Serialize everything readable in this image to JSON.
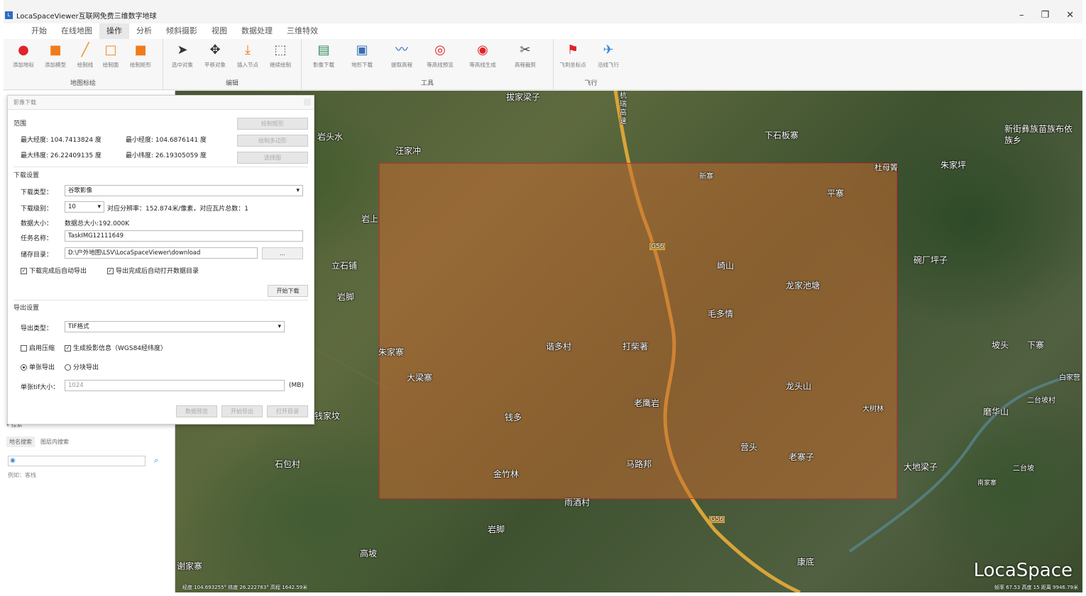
{
  "window": {
    "title": "LocaSpaceViewer互联网免费三维数字地球",
    "minimize": "–",
    "restore": "❐",
    "close": "✕"
  },
  "menu": [
    "开始",
    "在线地图",
    "操作",
    "分析",
    "倾斜摄影",
    "视图",
    "数据处理",
    "三维特效"
  ],
  "ribbon": {
    "groups": [
      {
        "label": "地图标绘",
        "buttons": [
          {
            "label": "添加地标",
            "icon": "location-pin-icon"
          },
          {
            "label": "添加模型",
            "icon": "cube-icon"
          },
          {
            "label": "绘制线",
            "icon": "line-icon"
          },
          {
            "label": "绘制面",
            "icon": "polygon-icon"
          },
          {
            "label": "绘制矩形",
            "icon": "rectangle-icon"
          }
        ]
      },
      {
        "label": "编辑",
        "buttons": [
          {
            "label": "选中对象",
            "icon": "cursor-icon"
          },
          {
            "label": "平移对象",
            "icon": "move-icon"
          },
          {
            "label": "插入节点",
            "icon": "insert-node-icon"
          },
          {
            "label": "继续绘制",
            "icon": "continue-draw-icon"
          }
        ]
      },
      {
        "label": "工具",
        "buttons": [
          {
            "label": "影像下载",
            "icon": "image-download-icon"
          },
          {
            "label": "地形下载",
            "icon": "terrain-download-icon"
          },
          {
            "label": "提取高程",
            "icon": "elevation-icon"
          },
          {
            "label": "等高线预览",
            "icon": "contour-preview-icon"
          },
          {
            "label": "等高线生成",
            "icon": "contour-generate-icon"
          },
          {
            "label": "高程裁剪",
            "icon": "scissors-icon"
          }
        ]
      },
      {
        "label": "飞行",
        "buttons": [
          {
            "label": "飞到坐标点",
            "icon": "fly-to-point-icon"
          },
          {
            "label": "沿线飞行",
            "icon": "airplane-icon"
          }
        ]
      }
    ]
  },
  "dialog": {
    "title": "影像下载",
    "range_title": "范围",
    "max_lon_label": "最大经度:",
    "max_lon": "104.7413824",
    "max_lon_unit": "度",
    "min_lon_label": "最小经度:",
    "min_lon": "104.6876141",
    "min_lon_unit": "度",
    "max_lat_label": "最大纬度:",
    "max_lat": "26.22409135",
    "max_lat_unit": "度",
    "min_lat_label": "最小纬度:",
    "min_lat": "26.19305059",
    "min_lat_unit": "度",
    "btn_draw_rect": "绘制矩形",
    "btn_draw_polygon": "绘制多边形",
    "btn_select_layer": "选择图",
    "download_settings": "下载设置",
    "dl_type_label": "下载类型：",
    "dl_type": "谷歌影像",
    "dl_level_label": "下载级别：",
    "dl_level": "10",
    "resolution_text": "对应分辨率：152.874米/像素，对应瓦片总数：1",
    "data_size_label": "数据大小：",
    "data_size": "数据总大小:192.000K",
    "task_name_label": "任务名称：",
    "task_name": "TaskIMG12111649",
    "save_dir_label": "储存目录：",
    "save_dir": "D:\\户外地图\\LSV\\LocaSpaceViewer\\download",
    "browse": "...",
    "cb_auto_export": "下载完成后自动导出",
    "cb_auto_open": "导出完成后自动打开数据目录",
    "btn_start_download": "开始下载",
    "export_settings": "导出设置",
    "export_type_label": "导出类型：",
    "export_type": "TIF格式",
    "cb_compress": "启用压缩",
    "cb_projection": "生成投影信息（WGS84经纬度）",
    "radio_single": "单张导出",
    "radio_block": "分块导出",
    "tif_size_label": "单张tif大小：",
    "tif_size": "1024",
    "tif_unit": "(MB)",
    "btn_preview": "数据预览",
    "btn_export": "开始导出",
    "btn_open_dir": "打开目录"
  },
  "sidebar": {
    "search_head": "搜索",
    "tabs": [
      "地名搜索",
      "图层内搜索"
    ],
    "example": "例如：客栈"
  },
  "map": {
    "places": [
      {
        "t": "拔家梁子"
      },
      {
        "t": "岩头水"
      },
      {
        "t": "汪家冲"
      },
      {
        "t": "下石板寨"
      },
      {
        "t": "新寨"
      },
      {
        "t": "杜母箐"
      },
      {
        "t": "朱家坪"
      },
      {
        "t": "新街彝族苗族布依族乡"
      },
      {
        "t": "平寨"
      },
      {
        "t": "岩上"
      },
      {
        "t": "立石铺"
      },
      {
        "t": "碗厂坪子"
      },
      {
        "t": "岩脚"
      },
      {
        "t": "崎山"
      },
      {
        "t": "龙家池塘"
      },
      {
        "t": "毛多情"
      },
      {
        "t": "坡头"
      },
      {
        "t": "下寨"
      },
      {
        "t": "朱家寨"
      },
      {
        "t": "谐多村"
      },
      {
        "t": "打柴著"
      },
      {
        "t": "大梁寨"
      },
      {
        "t": "白家营"
      },
      {
        "t": "二台坡村"
      },
      {
        "t": "龙头山"
      },
      {
        "t": "磨华山"
      },
      {
        "t": "老鹰岩"
      },
      {
        "t": "大树林"
      },
      {
        "t": "钱家坟"
      },
      {
        "t": "钱多"
      },
      {
        "t": "营头"
      },
      {
        "t": "老寨子"
      },
      {
        "t": "马路邦"
      },
      {
        "t": "金竹林"
      },
      {
        "t": "石包村"
      },
      {
        "t": "大地梁子"
      },
      {
        "t": "二台坡"
      },
      {
        "t": "南家寨"
      },
      {
        "t": "雨酒村"
      },
      {
        "t": "岩脚"
      },
      {
        "t": "高坡"
      },
      {
        "t": "谢家寨"
      },
      {
        "t": "康底"
      },
      {
        "t": "G56"
      },
      {
        "t": "G56"
      },
      {
        "t": "杭瑞高速"
      }
    ],
    "logo": "LocaSpace",
    "coords_left": "经度 104.693255°  纬度 26.222783°  高程 1642.59米",
    "coords_right": "帧率 67.53 高度 15 距离 9946.79米"
  },
  "colors": {
    "download_rect": "#c46a30",
    "rect_border": "#c03030",
    "road": "#d9a53a"
  }
}
